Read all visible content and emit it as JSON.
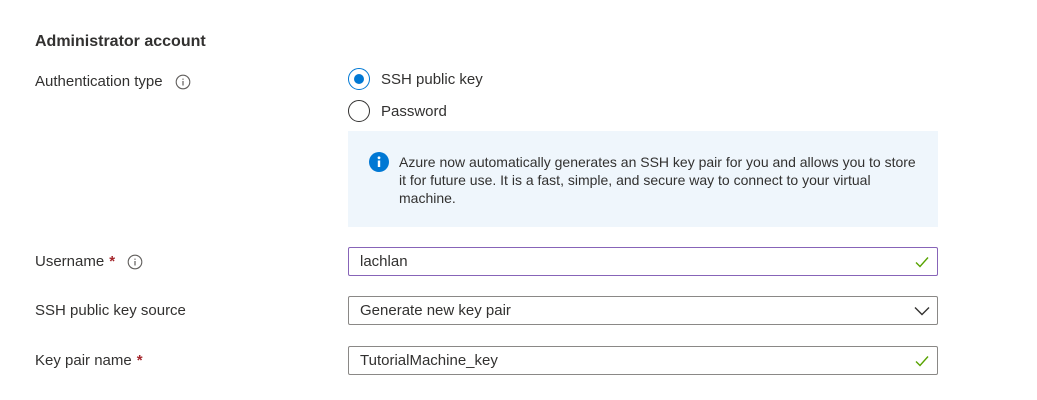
{
  "section": {
    "title": "Administrator account"
  },
  "auth": {
    "label": "Authentication type",
    "options": [
      {
        "label": "SSH public key",
        "selected": true
      },
      {
        "label": "Password",
        "selected": false
      }
    ]
  },
  "info_box": {
    "text": "Azure now automatically generates an SSH key pair for you and allows you to store it for future use. It is a fast, simple, and secure way to connect to your virtual machine."
  },
  "username": {
    "label": "Username",
    "required_mark": "*",
    "value": "lachlan"
  },
  "ssh_source": {
    "label": "SSH public key source",
    "value": "Generate new key pair"
  },
  "key_pair": {
    "label": "Key pair name",
    "required_mark": "*",
    "value": "TutorialMachine_key"
  },
  "colors": {
    "accent": "#0078d4",
    "valid": "#57a300",
    "required": "#a4262c",
    "info_bg": "#eff6fc",
    "focus_border": "#8764b8"
  }
}
